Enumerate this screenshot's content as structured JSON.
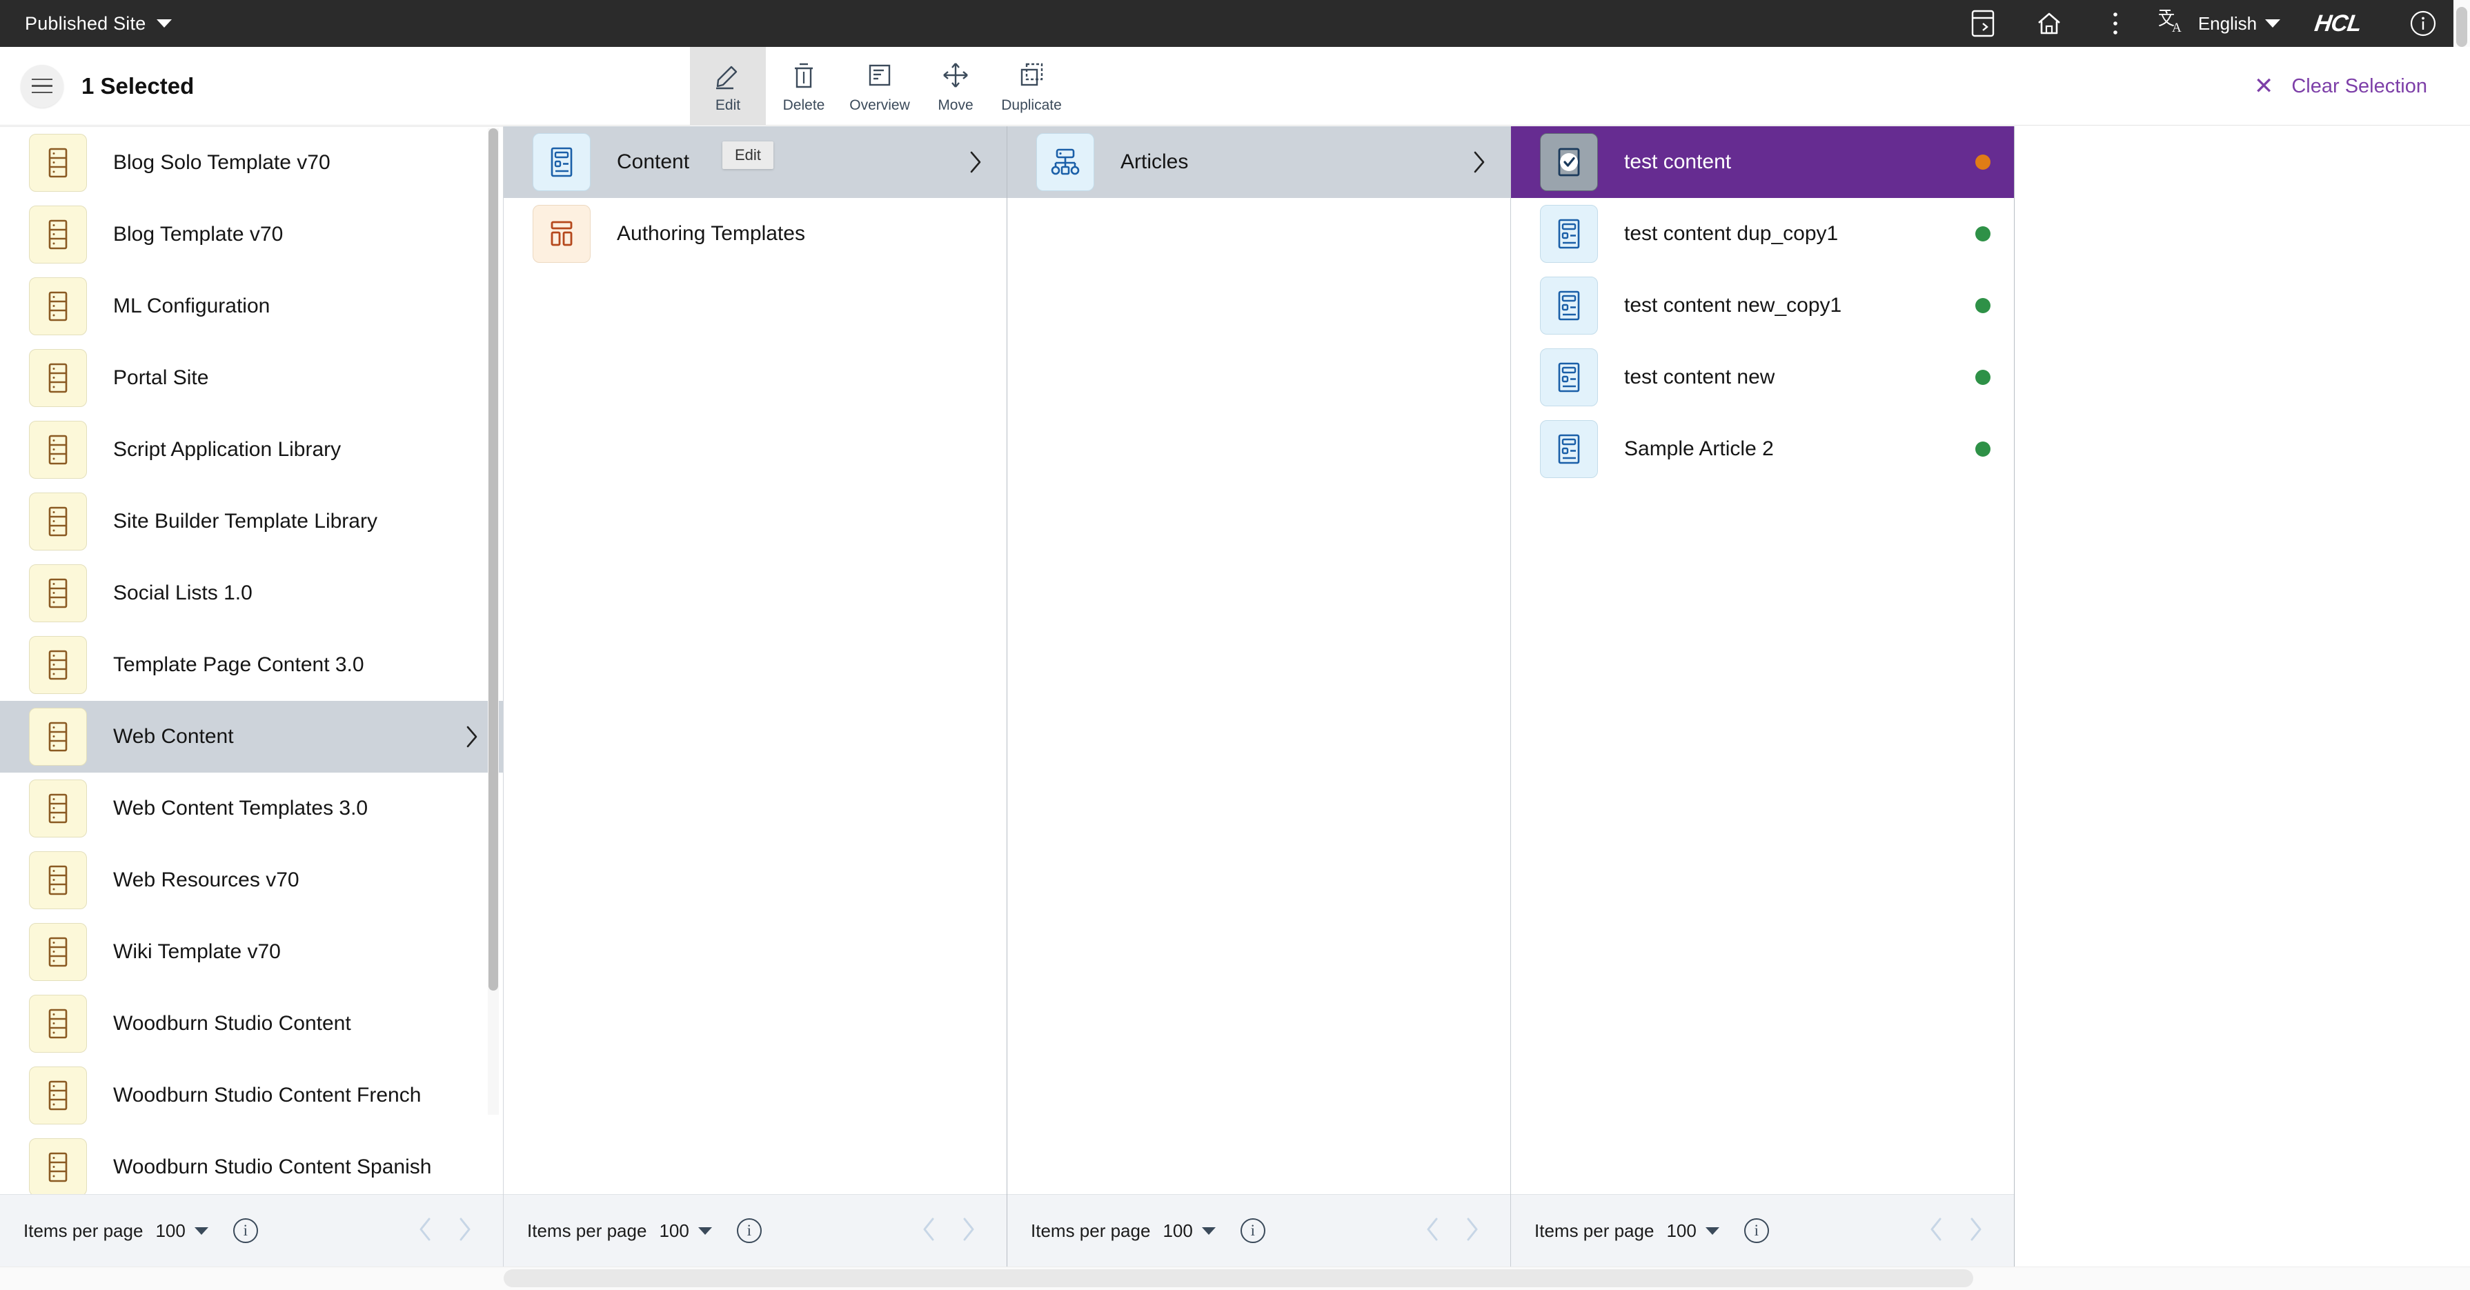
{
  "topbar": {
    "site_selector": "Published Site",
    "icons": [
      "panel-toggle-icon",
      "home-icon",
      "more-vertical-icon"
    ],
    "language": "English",
    "brand": "HCL",
    "info_icon": "info-icon"
  },
  "toolbar": {
    "menu_icon": "hamburger-icon",
    "selection_title": "1 Selected",
    "actions": [
      {
        "label": "Edit",
        "icon": "pencil-icon",
        "active": true
      },
      {
        "label": "Delete",
        "icon": "trash-icon",
        "active": false
      },
      {
        "label": "Overview",
        "icon": "document-icon",
        "active": false
      },
      {
        "label": "Move",
        "icon": "move-arrows-icon",
        "active": false
      },
      {
        "label": "Duplicate",
        "icon": "duplicate-icon",
        "active": false
      }
    ],
    "tooltip": "Edit",
    "clear_selection": "Clear Selection",
    "clear_icon": "close-icon",
    "accent_color": "#7d3fa8"
  },
  "footer": {
    "items_per_page_label": "Items per page",
    "items_per_page_value": "100",
    "info_icon": "info-icon",
    "prev_icon": "chevron-left-icon",
    "next_icon": "chevron-right-icon"
  },
  "columns": [
    {
      "id": "libraries",
      "scrollbar": true,
      "rows": [
        {
          "label": "Blog Solo Template v70",
          "icon": "library-icon",
          "tile": "cream",
          "state": "normal",
          "chevron": false,
          "dot": null
        },
        {
          "label": "Blog Template v70",
          "icon": "library-icon",
          "tile": "cream",
          "state": "normal",
          "chevron": false,
          "dot": null
        },
        {
          "label": "ML Configuration",
          "icon": "library-icon",
          "tile": "cream",
          "state": "normal",
          "chevron": false,
          "dot": null
        },
        {
          "label": "Portal Site",
          "icon": "library-icon",
          "tile": "cream",
          "state": "normal",
          "chevron": false,
          "dot": null
        },
        {
          "label": "Script Application Library",
          "icon": "library-icon",
          "tile": "cream",
          "state": "normal",
          "chevron": false,
          "dot": null
        },
        {
          "label": "Site Builder Template Library",
          "icon": "library-icon",
          "tile": "cream",
          "state": "normal",
          "chevron": false,
          "dot": null
        },
        {
          "label": "Social Lists 1.0",
          "icon": "library-icon",
          "tile": "cream",
          "state": "normal",
          "chevron": false,
          "dot": null
        },
        {
          "label": "Template Page Content 3.0",
          "icon": "library-icon",
          "tile": "cream",
          "state": "normal",
          "chevron": false,
          "dot": null
        },
        {
          "label": "Web Content",
          "icon": "library-icon",
          "tile": "cream",
          "state": "selected",
          "chevron": true,
          "dot": null
        },
        {
          "label": "Web Content Templates 3.0",
          "icon": "library-icon",
          "tile": "cream",
          "state": "normal",
          "chevron": false,
          "dot": null
        },
        {
          "label": "Web Resources v70",
          "icon": "library-icon",
          "tile": "cream",
          "state": "normal",
          "chevron": false,
          "dot": null
        },
        {
          "label": "Wiki Template v70",
          "icon": "library-icon",
          "tile": "cream",
          "state": "normal",
          "chevron": false,
          "dot": null
        },
        {
          "label": "Woodburn Studio Content",
          "icon": "library-icon",
          "tile": "cream",
          "state": "normal",
          "chevron": false,
          "dot": null
        },
        {
          "label": "Woodburn Studio Content French",
          "icon": "library-icon",
          "tile": "cream",
          "state": "normal",
          "chevron": false,
          "dot": null
        },
        {
          "label": "Woodburn Studio Content Spanish",
          "icon": "library-icon",
          "tile": "cream",
          "state": "normal",
          "chevron": false,
          "dot": null
        }
      ]
    },
    {
      "id": "web-content",
      "scrollbar": false,
      "rows": [
        {
          "label": "Content",
          "icon": "content-icon",
          "tile": "blue",
          "state": "selected",
          "chevron": true,
          "dot": null
        },
        {
          "label": "Authoring Templates",
          "icon": "authoring-template-icon",
          "tile": "peach",
          "state": "normal",
          "chevron": false,
          "dot": null
        }
      ]
    },
    {
      "id": "content",
      "scrollbar": false,
      "rows": [
        {
          "label": "Articles",
          "icon": "site-area-icon",
          "tile": "blue",
          "state": "selected",
          "chevron": true,
          "dot": null
        }
      ]
    },
    {
      "id": "articles",
      "scrollbar": false,
      "rows": [
        {
          "label": "test content",
          "icon": "checkbox-checked-icon",
          "tile": "gray",
          "state": "selected-purple",
          "chevron": false,
          "dot": "orange"
        },
        {
          "label": "test content dup_copy1",
          "icon": "content-icon",
          "tile": "blue",
          "state": "normal",
          "chevron": false,
          "dot": "green"
        },
        {
          "label": "test content new_copy1",
          "icon": "content-icon",
          "tile": "blue",
          "state": "normal",
          "chevron": false,
          "dot": "green"
        },
        {
          "label": "test content new",
          "icon": "content-icon",
          "tile": "blue",
          "state": "normal",
          "chevron": false,
          "dot": "green"
        },
        {
          "label": "Sample Article 2",
          "icon": "content-icon",
          "tile": "blue",
          "state": "normal",
          "chevron": false,
          "dot": "green"
        }
      ]
    }
  ]
}
